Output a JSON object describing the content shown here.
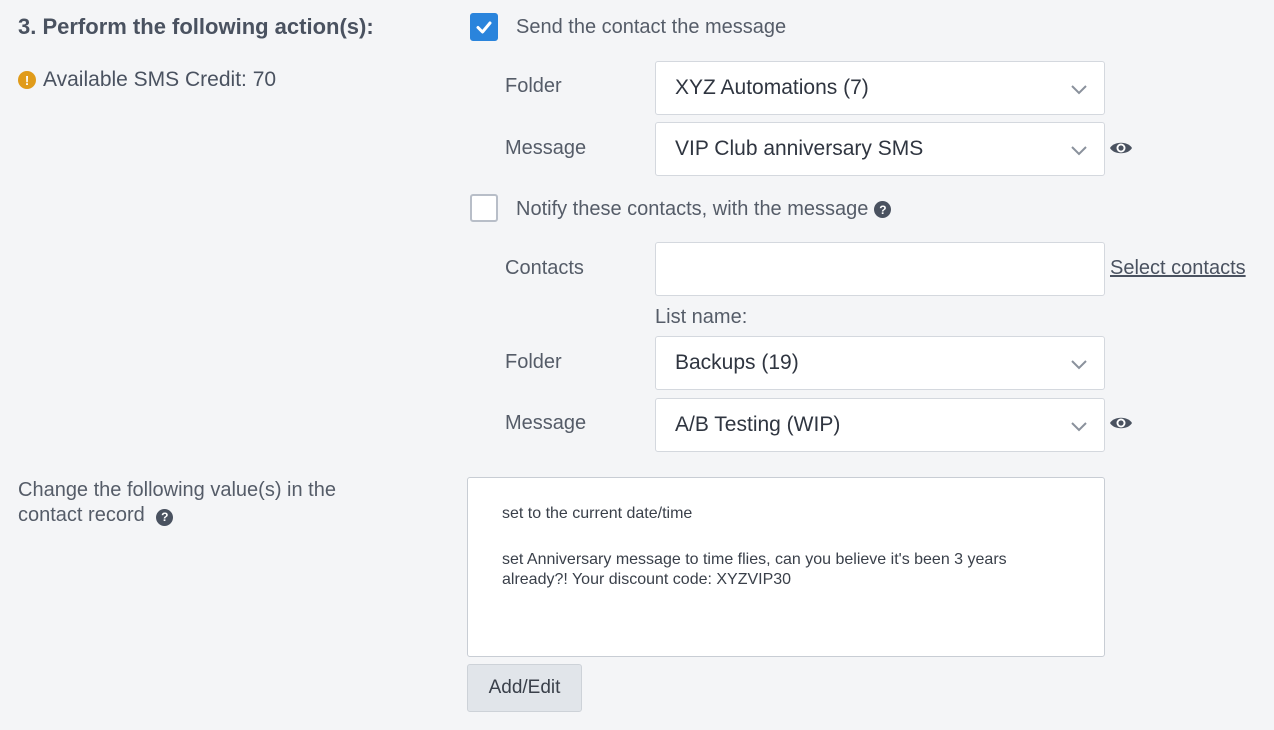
{
  "section": {
    "title": "3. Perform the following action(s):",
    "credit_text": "Available SMS Credit: 70"
  },
  "send_contact": {
    "checked": true,
    "label": "Send the contact the message",
    "folder_label": "Folder",
    "folder_value": "XYZ Automations (7)",
    "message_label": "Message",
    "message_value": "VIP Club anniversary SMS"
  },
  "notify": {
    "checked": false,
    "label": "Notify these contacts, with the message",
    "contacts_label": "Contacts",
    "contacts_value": "",
    "select_contacts_link": "Select contacts",
    "list_name_label": "List name:",
    "folder_label": "Folder",
    "folder_value": "Backups (19)",
    "message_label": "Message",
    "message_value": "A/B Testing (WIP)"
  },
  "change_values": {
    "label": "Change the following value(s) in the contact record",
    "lines": [
      "set to the current date/time",
      "set Anniversary message to time flies, can you believe it's been 3 years already?! Your discount code: XYZVIP30"
    ],
    "button_label": "Add/Edit"
  },
  "colors": {
    "accent": "#2a84dc",
    "warning": "#e09b1a",
    "background": "#f4f5f7"
  }
}
